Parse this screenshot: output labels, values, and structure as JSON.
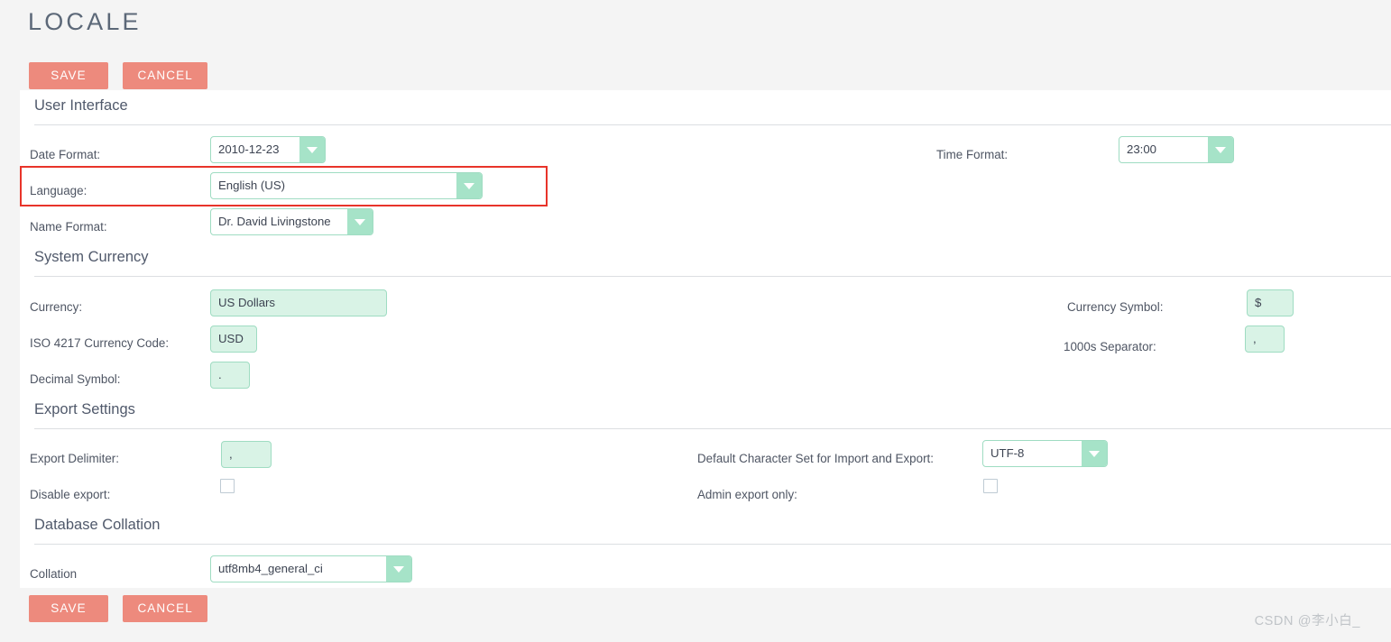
{
  "page": {
    "title": "LOCALE",
    "watermark": "CSDN @李小白_"
  },
  "actions": {
    "save_label": "SAVE",
    "cancel_label": "CANCEL",
    "save_label_bottom": "SAVE",
    "cancel_label_bottom": "CANCEL"
  },
  "colors": {
    "accent_button": "#ed8a7d",
    "field_fill": "#d9f3e6",
    "field_border": "#9fdcc2",
    "select_arrow": "#a6e3c8",
    "highlight": "#e8342a",
    "text": "#4e5563",
    "panel": "#ffffff",
    "background": "#f4f4f4"
  },
  "sections": [
    {
      "heading": "User Interface",
      "fields": [
        {
          "label": "Date Format:",
          "type": "select",
          "value": "2010-12-23"
        },
        {
          "label": "Time Format:",
          "type": "select",
          "value": "23:00"
        },
        {
          "label": "Language:",
          "type": "select",
          "value": "English (US)",
          "highlighted": true
        },
        {
          "label": "Name Format:",
          "type": "select",
          "value": "Dr. David Livingstone"
        }
      ]
    },
    {
      "heading": "System Currency",
      "fields": [
        {
          "label": "Currency:",
          "type": "input",
          "value": "US Dollars"
        },
        {
          "label": "Currency Symbol:",
          "type": "input",
          "value": "$"
        },
        {
          "label": "ISO 4217 Currency Code:",
          "type": "input",
          "value": "USD"
        },
        {
          "label": "1000s Separator:",
          "type": "input",
          "value": ","
        },
        {
          "label": "Decimal Symbol:",
          "type": "input",
          "value": "."
        }
      ]
    },
    {
      "heading": "Export Settings",
      "fields": [
        {
          "label": "Export Delimiter:",
          "type": "input",
          "value": ","
        },
        {
          "label": "Default Character Set for Import and Export:",
          "type": "select",
          "value": "UTF-8"
        },
        {
          "label": "Disable export:",
          "type": "checkbox",
          "checked": false
        },
        {
          "label": "Admin export only:",
          "type": "checkbox",
          "checked": false
        }
      ]
    },
    {
      "heading": "Database Collation",
      "fields": [
        {
          "label": "Collation",
          "type": "select",
          "value": "utf8mb4_general_ci"
        }
      ]
    }
  ]
}
